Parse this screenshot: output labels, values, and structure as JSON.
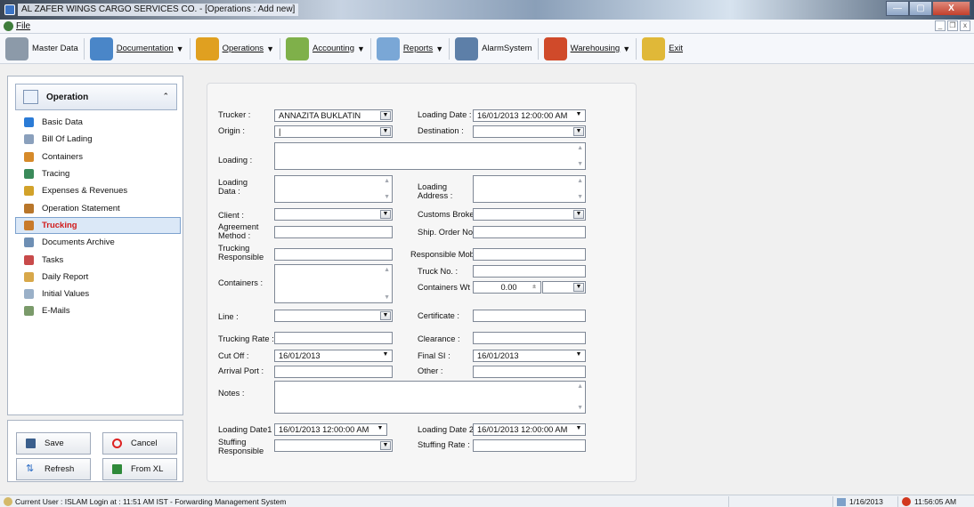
{
  "window": {
    "title": "AL ZAFER WINGS CARGO SERVICES CO. - [Operations : Add new]",
    "min": "—",
    "max": "▢",
    "close": "X"
  },
  "menu": {
    "file": "File"
  },
  "toolbar": [
    {
      "id": "master-data",
      "label": "Master Data",
      "dropdown": false,
      "color": "#8c9aa9"
    },
    {
      "id": "documentation",
      "label": "Documentation",
      "dropdown": true,
      "color": "#4a86c8"
    },
    {
      "id": "operations",
      "label": "Operations",
      "dropdown": true,
      "color": "#e0a020"
    },
    {
      "id": "accounting",
      "label": "Accounting",
      "dropdown": true,
      "color": "#7fb04a"
    },
    {
      "id": "reports",
      "label": "Reports",
      "dropdown": true,
      "color": "#7aa7d6"
    },
    {
      "id": "alarm-system",
      "label": "AlarmSystem",
      "dropdown": false,
      "color": "#5d7fa8"
    },
    {
      "id": "warehousing",
      "label": "Warehousing",
      "dropdown": true,
      "color": "#d04a2a"
    },
    {
      "id": "exit",
      "label": "Exit",
      "dropdown": false,
      "color": "#e0b838"
    }
  ],
  "sidebar": {
    "title": "Operation",
    "collapse": "⌃",
    "items": [
      {
        "id": "basic-data",
        "label": "Basic Data",
        "color": "#2b7bd6"
      },
      {
        "id": "bill-of-lading",
        "label": "Bill Of Lading",
        "color": "#8aa0bc"
      },
      {
        "id": "containers",
        "label": "Containers",
        "color": "#d68a2a"
      },
      {
        "id": "tracing",
        "label": "Tracing",
        "color": "#3a8a5a"
      },
      {
        "id": "expenses-revenues",
        "label": "Expenses & Revenues",
        "color": "#d2a22a"
      },
      {
        "id": "operation-statement",
        "label": "Operation Statement",
        "color": "#b8762a"
      },
      {
        "id": "trucking",
        "label": "Trucking",
        "color": "#c87a2a",
        "active": true
      },
      {
        "id": "documents-archive",
        "label": "Documents Archive",
        "color": "#6e8fb4"
      },
      {
        "id": "tasks",
        "label": "Tasks",
        "color": "#c84a4a"
      },
      {
        "id": "daily-report",
        "label": "Daily Report",
        "color": "#d8a84a"
      },
      {
        "id": "initial-values",
        "label": "Initial Values",
        "color": "#9ab0c8"
      },
      {
        "id": "e-mails",
        "label": "E-Mails",
        "color": "#7a9a6a"
      }
    ]
  },
  "actions": {
    "save": "Save",
    "cancel": "Cancel",
    "refresh": "Refresh",
    "from_xl": "From XL"
  },
  "form": {
    "trucker_label": "Trucker :",
    "trucker_value": "ANNAZITA BUKLATIN",
    "loading_date_label": "Loading Date :",
    "loading_date_value": "16/01/2013 12:00:00 AM",
    "origin_label": "Origin :",
    "origin_value": "|",
    "destination_label": "Destination :",
    "destination_value": "",
    "loading_label": "Loading :",
    "loading_data_label1": "Loading",
    "loading_data_label2": "Data :",
    "loading_address_label1": "Loading",
    "loading_address_label2": "Address :",
    "client_label": "Client :",
    "customs_broker_label": "Customs Broker",
    "agreement_label1": "Agreement",
    "agreement_label2": "Method :",
    "ship_order_label": "Ship. Order No.",
    "trucking_resp_label1": "Trucking",
    "trucking_resp_label2": "Responsible",
    "responsible_mob_label": "Responsible Mob",
    "truck_no_label": "Truck No. :",
    "containers_label": "Containers :",
    "containers_wt_label": "Containers Wt :",
    "containers_wt_value": "0.00",
    "line_label": "Line :",
    "certificate_label": "Certificate :",
    "trucking_rate_label": "Trucking Rate :",
    "clearance_label": "Clearance :",
    "cut_off_label": "Cut Off :",
    "cut_off_value": "16/01/2013",
    "final_si_label": "Final SI :",
    "final_si_value": "16/01/2013",
    "arrival_port_label": "Arrival Port :",
    "other_label": "Other :",
    "notes_label": "Notes :",
    "loading_date1_label": "Loading Date1 :",
    "loading_date1_value": "16/01/2013 12:00:00 AM",
    "loading_date2_label": "Loading Date 2 :",
    "loading_date2_value": "16/01/2013 12:00:00 AM",
    "stuffing_resp_label1": "Stuffing",
    "stuffing_resp_label2": "Responsible",
    "stuffing_rate_label": "Stuffing Rate :"
  },
  "status": {
    "text": "Current User : ISLAM   Login at : 11:51 AM  IST - Forwarding Management System",
    "date": "1/16/2013",
    "time": "11:56:05 AM"
  }
}
